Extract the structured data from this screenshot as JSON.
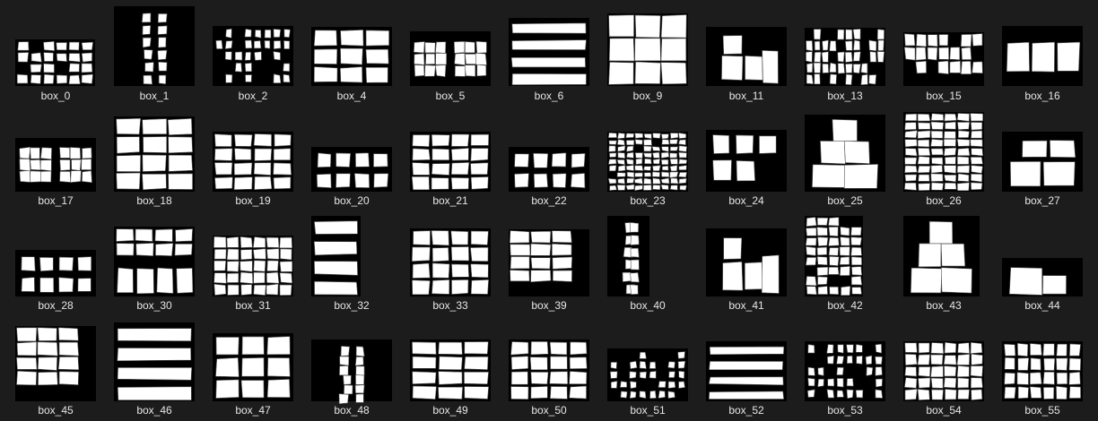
{
  "files": [
    {
      "label": "box_0",
      "kind": "grid_rows"
    },
    {
      "label": "box_1",
      "kind": "column_sparse"
    },
    {
      "label": "box_2",
      "kind": "grid_small"
    },
    {
      "label": "box_4",
      "kind": "brick_stack"
    },
    {
      "label": "box_5",
      "kind": "two_stacks"
    },
    {
      "label": "box_6",
      "kind": "perspective_shelves"
    },
    {
      "label": "box_9",
      "kind": "big_panel"
    },
    {
      "label": "box_11",
      "kind": "few_boxes"
    },
    {
      "label": "box_13",
      "kind": "bar_grid"
    },
    {
      "label": "box_15",
      "kind": "stacked_tall"
    },
    {
      "label": "box_16",
      "kind": "three_large"
    },
    {
      "label": "box_17",
      "kind": "two_stacks"
    },
    {
      "label": "box_18",
      "kind": "perspective_cube"
    },
    {
      "label": "box_19",
      "kind": "perspective_walls"
    },
    {
      "label": "box_20",
      "kind": "row_squares"
    },
    {
      "label": "box_21",
      "kind": "perspective_walls"
    },
    {
      "label": "box_22",
      "kind": "row_squares"
    },
    {
      "label": "box_23",
      "kind": "dense_grid"
    },
    {
      "label": "box_24",
      "kind": "five_squares"
    },
    {
      "label": "box_25",
      "kind": "pyramid"
    },
    {
      "label": "box_26",
      "kind": "big_grid"
    },
    {
      "label": "box_27",
      "kind": "four_boxes"
    },
    {
      "label": "box_28",
      "kind": "row_squares"
    },
    {
      "label": "box_30",
      "kind": "split_rows"
    },
    {
      "label": "box_31",
      "kind": "dense_wall"
    },
    {
      "label": "box_32",
      "kind": "perspective_shelves"
    },
    {
      "label": "box_33",
      "kind": "perspective_walls"
    },
    {
      "label": "box_39",
      "kind": "pile"
    },
    {
      "label": "box_40",
      "kind": "column_sparse"
    },
    {
      "label": "box_41",
      "kind": "few_boxes"
    },
    {
      "label": "box_42",
      "kind": "column_grid"
    },
    {
      "label": "box_43",
      "kind": "pyramid"
    },
    {
      "label": "box_44",
      "kind": "small_pile"
    },
    {
      "label": "box_45",
      "kind": "pile"
    },
    {
      "label": "box_46",
      "kind": "perspective_shelves"
    },
    {
      "label": "box_47",
      "kind": "brick_stack"
    },
    {
      "label": "box_48",
      "kind": "column_sparse"
    },
    {
      "label": "box_49",
      "kind": "perspective_cube"
    },
    {
      "label": "box_50",
      "kind": "perspective_walls"
    },
    {
      "label": "box_51",
      "kind": "grid_small"
    },
    {
      "label": "box_52",
      "kind": "perspective_shelves"
    },
    {
      "label": "box_53",
      "kind": "grid_small"
    },
    {
      "label": "box_54",
      "kind": "dense_wall"
    },
    {
      "label": "box_55",
      "kind": "grid_rows"
    }
  ]
}
